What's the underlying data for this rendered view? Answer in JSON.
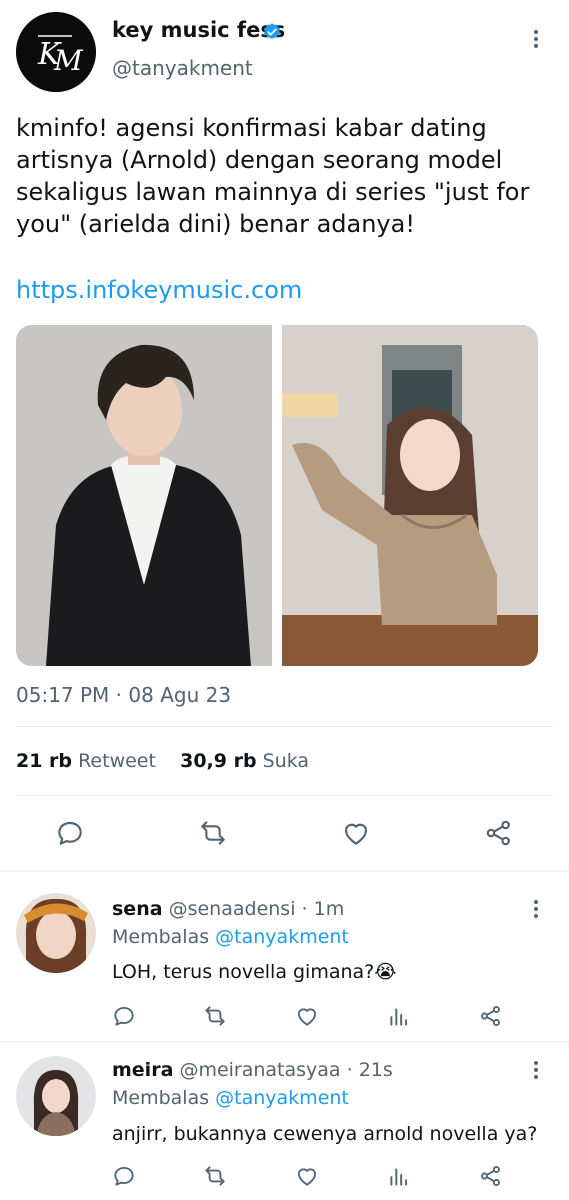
{
  "tweet": {
    "avatar_text": "KM",
    "display_name": "key music fess",
    "handle": "@tanyakment",
    "text": "kminfo! agensi konfirmasi kabar dating artisnya (Arnold) dengan seorang model sekaligus lawan mainnya di series \"just for you\" (arielda dini) benar adanya!",
    "link": "https.infokeymusic.com",
    "timestamp": "05:17 PM · 08 Agu 23",
    "retweet_count": "21 rb",
    "retweet_label": "Retweet",
    "like_count": "30,9 rb",
    "like_label": "Suka"
  },
  "replies": [
    {
      "name": "sena",
      "handle": "@senaadensi",
      "time": "· 1m",
      "replying_prefix": "Membalas",
      "replying_to": "@tanyakment",
      "text": "LOH, terus novella gimana?😭"
    },
    {
      "name": "meira",
      "handle": "@meiranatasyaa",
      "time": "· 21s",
      "replying_prefix": "Membalas",
      "replying_to": "@tanyakment",
      "text": "anjirr, bukannya cewenya arnold novella ya?"
    }
  ],
  "colors": {
    "accent": "#1d9bf0",
    "text": "#0f1419",
    "muted": "#536471",
    "divider": "#e6ecf0"
  }
}
